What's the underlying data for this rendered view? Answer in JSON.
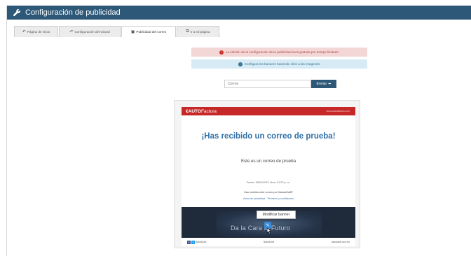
{
  "window": {
    "title": "Configuración de publicidad",
    "title_icon": "wrench-icon"
  },
  "tabs": [
    {
      "label": "Página de inicio",
      "icon": "back-arrow-icon",
      "active": false
    },
    {
      "label": "Configuración del wizard",
      "icon": "back-arrow-icon",
      "active": false
    },
    {
      "label": "Publicidad del correo",
      "icon": "image-icon",
      "active": true
    },
    {
      "label": "Ir a mi página",
      "icon": "external-link-icon",
      "active": false
    }
  ],
  "alerts": {
    "warning": "La edición de la configuración de la publicidad será gratuita por tiempo limitado.",
    "info": "Configura los banners haciendo click a las imagenes."
  },
  "email_form": {
    "placeholder": "Correo",
    "send_label": "Enviar"
  },
  "preview": {
    "logo_prefix": "€",
    "logo_main": "AUTO",
    "logo_light": "Factura",
    "header_right": "www.autofactura.com",
    "heading": "¡Has recibido un correo de prueba!",
    "body_text": "Este es un correo de prueba",
    "date_text": "Fecha: 26/01/2015 Hora: 01:20 p. m.",
    "note_text": "Has recibido este correo por NaturaSoft®",
    "links_text": "Aviso de privacidad  ·  Términos y condiciones",
    "banner_text": "Da la Cara al Futuro",
    "modify_label": "Modificar banner",
    "footer_social": "NaturaSoft",
    "footer_center": "NaturaSoft",
    "footer_right": "naturasoft.com.mx"
  },
  "colors": {
    "titlebar": "#2d5878",
    "alert_red_bg": "#f3d6d6",
    "alert_blue_bg": "#d6ebf5",
    "email_header": "#c62828",
    "heading_blue": "#2f6fa7"
  }
}
